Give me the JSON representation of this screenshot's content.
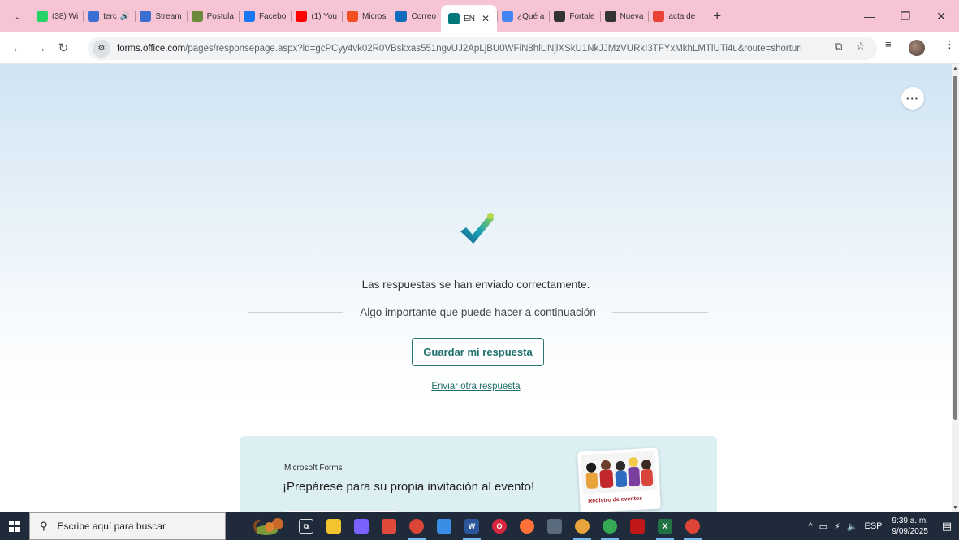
{
  "browser": {
    "tabs": [
      {
        "label": "(38) Wi",
        "icon": "whatsapp-icon",
        "color": "#25d366"
      },
      {
        "label": "terc",
        "icon": "stream-icon",
        "color": "#3b6fd1",
        "extra": "🔊"
      },
      {
        "label": "Stream",
        "icon": "stream-icon",
        "color": "#3b6fd1"
      },
      {
        "label": "Postula",
        "icon": "user-icon",
        "color": "#6a8a3a"
      },
      {
        "label": "Facebo",
        "icon": "facebook-icon",
        "color": "#1877f2"
      },
      {
        "label": "(1) You",
        "icon": "youtube-icon",
        "color": "#ff0000"
      },
      {
        "label": "Micros",
        "icon": "microsoft-icon",
        "color": "#f25022"
      },
      {
        "label": "Correo",
        "icon": "outlook-icon",
        "color": "#0f6cbd"
      },
      {
        "label": "EN",
        "icon": "forms-icon",
        "color": "#03787c",
        "active": true
      },
      {
        "label": "¿Qué a",
        "icon": "google-icon",
        "color": "#4285f4"
      },
      {
        "label": "Fortale",
        "icon": "openai-icon",
        "color": "#333333"
      },
      {
        "label": "Nueva",
        "icon": "chrome-icon",
        "color": "#333333"
      },
      {
        "label": "acta de",
        "icon": "gmail-icon",
        "color": "#ea4335"
      }
    ],
    "new_tab": "+",
    "url_host": "forms.office.com",
    "url_path": "/pages/responsepage.aspx?id=gcPCyy4vk02R0VBskxas551ngvUJ2ApLjBU0WFiN8hlUNjlXSkU1NkJJMzVURkI3TFYxMkhLMTlUTi4u&route=shorturl"
  },
  "page": {
    "success_message": "Las respuestas se han enviado correctamente.",
    "next_heading": "Algo importante que puede hacer a continuación",
    "save_button": "Guardar mi respuesta",
    "send_another_link": "Enviar otra respuesta",
    "more_button": "···",
    "promo": {
      "brand": "Microsoft Forms",
      "title": "¡Prepárese para su propia invitación al evento!",
      "card_text": "Registro de eventos"
    }
  },
  "taskbar": {
    "search_placeholder": "Escribe aquí para buscar",
    "language": "ESP",
    "time": "9:39 a. m.",
    "date": "9/09/2025"
  },
  "colors": {
    "tabbar": "#f6c4d2",
    "accent": "#1f6f6d",
    "taskbar": "#1f2a3a"
  }
}
